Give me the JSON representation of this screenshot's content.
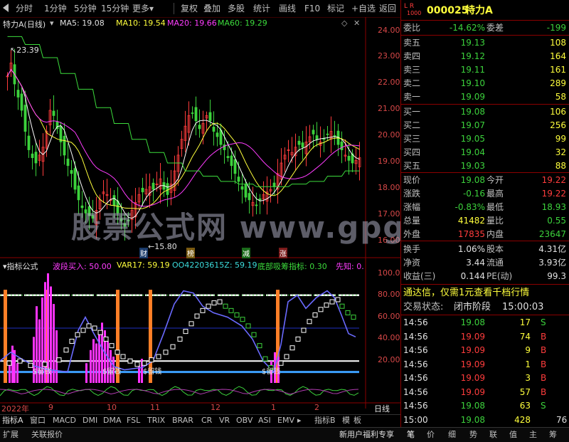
{
  "toolbar": {
    "left_items": [
      "分时",
      "1分钟",
      "5分钟",
      "15分钟",
      "更多"
    ],
    "more_arrow": "▾",
    "right_items": [
      "复权",
      "叠加",
      "多股",
      "统计",
      "画线",
      "F10",
      "标记",
      "+自选",
      "返回"
    ]
  },
  "main_chart": {
    "stock_title": "特力A(日线)",
    "ma5": "MA5: 19.08",
    "ma10": "MA10: 19.54",
    "ma20": "MA20: 19.66",
    "ma60": "MA60: 19.29",
    "y_ticks": [
      "24.00",
      "23.00",
      "22.00",
      "21.00",
      "20.00",
      "19.00",
      "18.00",
      "17.00",
      "16.00"
    ],
    "high_label": "23.39",
    "low_label": "15.80",
    "event_badges": [
      "财",
      "榜",
      "减",
      "涨"
    ],
    "watermark": "股票公式网 www.gpgs.com"
  },
  "indicator_chart": {
    "title": "指标公式",
    "params": [
      "波段买入: 50.00",
      "VAR17: 59.19",
      "OO42203615Z: 59.19",
      "底部吸筹指标: 0.30",
      "先知: 0."
    ],
    "y_ticks": [
      "100.00",
      "80.00",
      "60.00",
      "40.00",
      "20.00"
    ],
    "buy_labels": [
      "$留钱",
      "$留钱",
      "$留钱",
      "$留钱"
    ]
  },
  "date_axis": {
    "labels": [
      "2022年",
      "9",
      "10",
      "11",
      "12",
      "1",
      "2"
    ],
    "period": "日线"
  },
  "indicator_tabs": [
    "指标A",
    "窗口",
    "MACD",
    "DMI",
    "DMA",
    "FSL",
    "TRIX",
    "BRAR",
    "CR",
    "VR",
    "OBV",
    "ASI",
    "EMV"
  ],
  "indicator_tabs_right": [
    "指标B",
    "模",
    "板"
  ],
  "footer": {
    "left": [
      "扩展",
      "关联报价"
    ],
    "promo": "新用户福利专享",
    "right_tabs": [
      "笔",
      "价",
      "细",
      "势",
      "联",
      "值",
      "主",
      "筹"
    ]
  },
  "quote": {
    "code": "000025",
    "name": "特力A",
    "badge_top": "L R",
    "badge_bot": "1000",
    "wei_bi_label": "委比",
    "wei_bi": "-14.62%",
    "wei_cha_label": "委差",
    "wei_cha": "-199",
    "asks": [
      {
        "label": "卖五",
        "price": "19.13",
        "vol": "108"
      },
      {
        "label": "卖四",
        "price": "19.12",
        "vol": "164"
      },
      {
        "label": "卖三",
        "price": "19.11",
        "vol": "161"
      },
      {
        "label": "卖二",
        "price": "19.10",
        "vol": "289"
      },
      {
        "label": "卖一",
        "price": "19.09",
        "vol": "58"
      }
    ],
    "bids": [
      {
        "label": "买一",
        "price": "19.08",
        "vol": "106"
      },
      {
        "label": "买二",
        "price": "19.07",
        "vol": "256"
      },
      {
        "label": "买三",
        "price": "19.05",
        "vol": "99"
      },
      {
        "label": "买四",
        "price": "19.04",
        "vol": "32"
      },
      {
        "label": "买五",
        "price": "19.03",
        "vol": "88"
      }
    ],
    "stats": [
      {
        "l1": "现价",
        "v1": "19.08",
        "c1": "grn",
        "l2": "今开",
        "v2": "19.22",
        "c2": "red"
      },
      {
        "l1": "涨跌",
        "v1": "-0.16",
        "c1": "grn",
        "l2": "最高",
        "v2": "19.22",
        "c2": "red"
      },
      {
        "l1": "涨幅",
        "v1": "-0.83%",
        "c1": "grn",
        "l2": "最低",
        "v2": "18.93",
        "c2": "grn"
      },
      {
        "l1": "总量",
        "v1": "41482",
        "c1": "yel",
        "l2": "量比",
        "v2": "0.55",
        "c2": "grn"
      },
      {
        "l1": "外盘",
        "v1": "17835",
        "c1": "red",
        "l2": "内盘",
        "v2": "23647",
        "c2": "grn"
      }
    ],
    "stats2": [
      {
        "l1": "换手",
        "v1": "1.06%",
        "l2": "股本",
        "v2": "4.31亿"
      },
      {
        "l1": "净资",
        "v1": "3.44",
        "l2": "流通",
        "v2": "3.93亿"
      },
      {
        "l1": "收益(三)",
        "v1": "0.144",
        "l2": "PE(动)",
        "v2": "99.3"
      }
    ],
    "promo": "通达信，仅需1元查看千档行情",
    "status_label": "交易状态:",
    "status_value": "闭市阶段",
    "status_time": "15:00:03",
    "ticks": [
      {
        "t": "14:56",
        "p": "19.08",
        "pc": "grn",
        "v": "17",
        "s": "S"
      },
      {
        "t": "14:56",
        "p": "19.09",
        "pc": "red",
        "v": "74",
        "s": "B"
      },
      {
        "t": "14:56",
        "p": "19.09",
        "pc": "red",
        "v": "9",
        "s": "B"
      },
      {
        "t": "14:56",
        "p": "19.09",
        "pc": "red",
        "v": "1",
        "s": "B"
      },
      {
        "t": "14:56",
        "p": "19.09",
        "pc": "red",
        "v": "3",
        "s": "B"
      },
      {
        "t": "14:56",
        "p": "19.09",
        "pc": "red",
        "v": "57",
        "s": "B"
      },
      {
        "t": "14:56",
        "p": "19.08",
        "pc": "grn",
        "v": "63",
        "s": "S"
      },
      {
        "t": "15:00",
        "p": "19.08",
        "pc": "grn",
        "v": "428",
        "s": ""
      }
    ],
    "tick_last_extra": "76"
  },
  "colors": {
    "up": "#ff3c3c",
    "down": "#3cd23c",
    "ma5": "#ffffff",
    "ma10": "#ffff3c",
    "ma20": "#ff3cff",
    "ma60": "#3cdc3c",
    "axis": "#8b0000"
  }
}
